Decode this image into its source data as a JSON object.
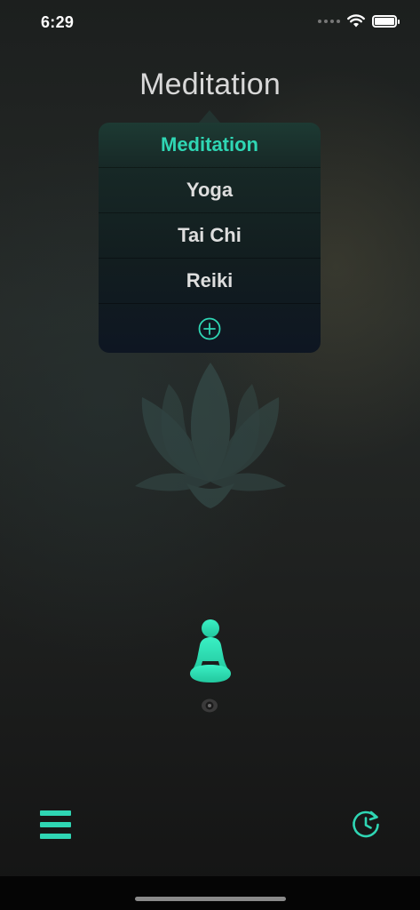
{
  "status_bar": {
    "time": "6:29",
    "icons": [
      "signal-dots-icon",
      "wifi-icon",
      "battery-icon"
    ]
  },
  "header": {
    "title": "Meditation"
  },
  "dropdown": {
    "items": [
      {
        "label": "Meditation",
        "selected": true
      },
      {
        "label": "Yoga",
        "selected": false
      },
      {
        "label": "Tai Chi",
        "selected": false
      },
      {
        "label": "Reiki",
        "selected": false
      }
    ],
    "add_icon": "plus-circle-icon"
  },
  "background_icon": "lotus-icon",
  "center_icon": "meditation-figure-icon",
  "indicator_icon": "eye-icon",
  "toolbar": {
    "left_icon": "menu-icon",
    "right_icon": "history-timer-icon"
  },
  "colors": {
    "accent": "#2fd6b4",
    "text": "#dedede",
    "title": "#d8d8d8",
    "background": "#1e201f"
  }
}
